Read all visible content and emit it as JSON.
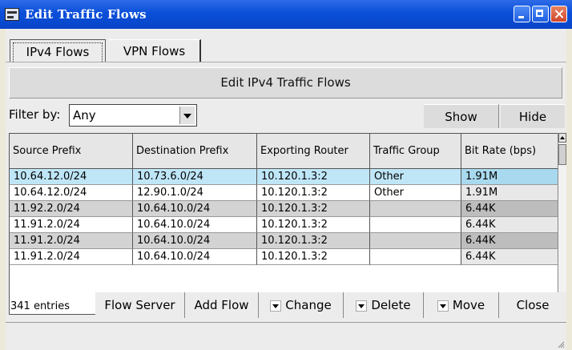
{
  "window": {
    "title": "Edit Traffic Flows"
  },
  "tabs": [
    {
      "label": "IPv4 Flows"
    },
    {
      "label": "VPN Flows"
    }
  ],
  "heading": "Edit IPv4 Traffic Flows",
  "filter": {
    "label": "Filter by:",
    "value": "Any"
  },
  "actions": {
    "show": "Show",
    "hide": "Hide"
  },
  "table": {
    "columns": [
      "Source Prefix",
      "Destination Prefix",
      "Exporting Router",
      "Traffic Group",
      "Bit Rate (bps)"
    ],
    "rows": [
      [
        "10.64.12.0/24",
        "10.73.6.0/24",
        "10.120.1.3:2",
        "Other",
        "1.91M"
      ],
      [
        "10.64.12.0/24",
        "12.90.1.0/24",
        "10.120.1.3:2",
        "Other",
        "1.91M"
      ],
      [
        "11.92.2.0/24",
        "10.64.10.0/24",
        "10.120.1.3:2",
        "",
        "6.44K"
      ],
      [
        "11.91.2.0/24",
        "10.64.10.0/24",
        "10.120.1.3:2",
        "",
        "6.44K"
      ],
      [
        "11.91.2.0/24",
        "10.64.10.0/24",
        "10.120.1.3:2",
        "",
        "6.44K"
      ],
      [
        "11.91.2.0/24",
        "10.64.10.0/24",
        "10.120.1.3:2",
        "",
        "6.44K"
      ]
    ]
  },
  "footer": {
    "entries": "341 entries",
    "flow_server": "Flow Server",
    "add_flow": "Add Flow",
    "change": "Change",
    "delete": "Delete",
    "move": "Move",
    "close": "Close"
  },
  "colors": {
    "selected_row": "#bfe6f7",
    "alt_row": "#d3d3d3",
    "bitrate_col_alt": "#bdbdbd"
  }
}
